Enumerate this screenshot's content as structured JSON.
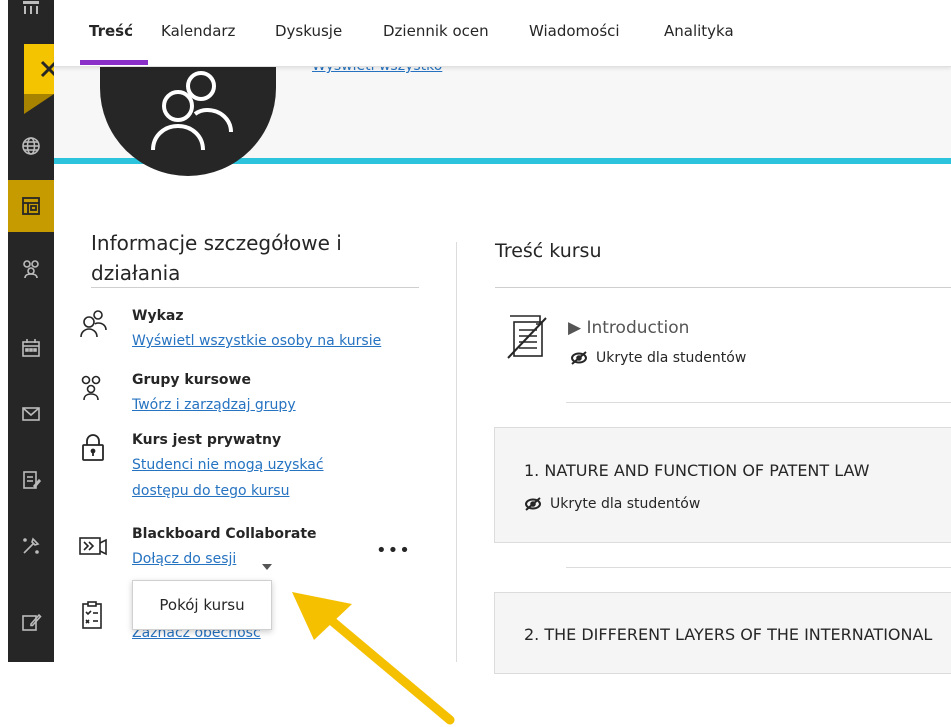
{
  "nav": {
    "tabs": [
      "Treść",
      "Kalendarz",
      "Dyskusje",
      "Dziennik ocen",
      "Wiadomości",
      "Analityka"
    ],
    "active_tab": "Treść"
  },
  "banner": {
    "link_text": "Wyświetl wszystko"
  },
  "sidebar": {
    "title": "Informacje szczegółowe i działania",
    "items": [
      {
        "icon": "roster-icon",
        "title": "Wykaz",
        "link": "Wyświetl wszystkie osoby na kursie"
      },
      {
        "icon": "groups-icon",
        "title": "Grupy kursowe",
        "link": "Twórz i zarządzaj grupy"
      },
      {
        "icon": "lock-icon",
        "title": "Kurs jest prywatny",
        "link": "Studenci nie mogą uzyskać dostępu do tego kursu"
      },
      {
        "icon": "video-icon",
        "title": "Blackboard Collaborate",
        "link": "Dołącz do sesji"
      },
      {
        "icon": "attendance-icon",
        "title": "",
        "link": "Zaznacz obecność"
      }
    ],
    "more_label": "•••",
    "dropdown_option": "Pokój kursu"
  },
  "content": {
    "title": "Treść kursu",
    "intro": {
      "title": "▶ Introduction",
      "status": "Ukryte dla studentów"
    },
    "cards": [
      {
        "title": "1. NATURE AND FUNCTION OF PATENT LAW",
        "status": "Ukryte dla studentów"
      },
      {
        "title": "2. THE DIFFERENT LAYERS OF THE INTERNATIONAL",
        "status": ""
      }
    ]
  },
  "colors": {
    "accent_yellow": "#f5c400",
    "nav_underline": "#8b2fc9",
    "link": "#2673c1",
    "cyan_line": "#2cc3dd",
    "rail": "#262626"
  }
}
